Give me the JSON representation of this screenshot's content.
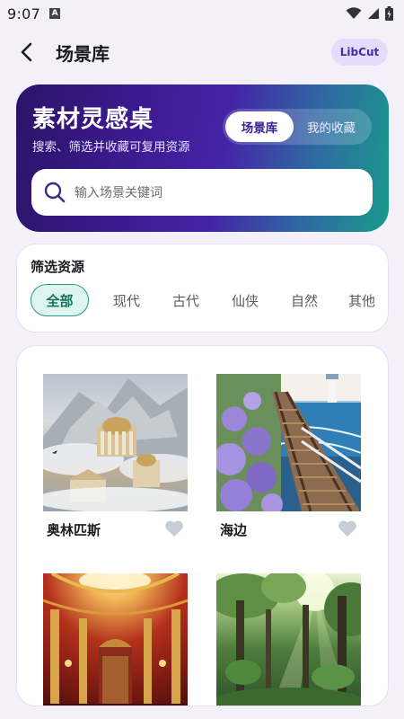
{
  "status_bar": {
    "time": "9:07",
    "notif_letter": "A"
  },
  "header": {
    "title": "场景库",
    "badge": "LibCut"
  },
  "hero": {
    "title": "素材灵感桌",
    "subtitle": "搜索、筛选并收藏可复用资源",
    "segments": [
      {
        "label": "场景库",
        "selected": true
      },
      {
        "label": "我的收藏",
        "selected": false
      }
    ],
    "search_placeholder": "输入场景关键词"
  },
  "filter": {
    "title": "筛选资源",
    "chips": [
      "全部",
      "现代",
      "古代",
      "仙侠",
      "自然",
      "其他"
    ],
    "selected": "全部"
  },
  "scenes": [
    {
      "name": "奥林匹斯",
      "favorited": false,
      "image": "greek-temple-mountain"
    },
    {
      "name": "海边",
      "favorited": false,
      "image": "seaside-railway-flowers"
    },
    {
      "name": "",
      "favorited": false,
      "image": "golden-palace-hall"
    },
    {
      "name": "",
      "favorited": false,
      "image": "sunlit-forest"
    }
  ],
  "colors": {
    "accent": "#4a2aa5",
    "teal": "#2b9a85",
    "background": "#f3f0fa",
    "heart": "#c5cdd6"
  }
}
